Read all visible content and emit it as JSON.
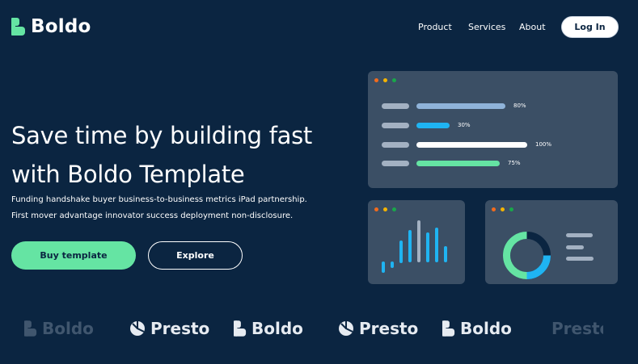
{
  "brand": {
    "name": "Boldo",
    "accent": "#65e4a3"
  },
  "nav": {
    "items": [
      {
        "label": "Product"
      },
      {
        "label": "Services"
      },
      {
        "label": "About"
      }
    ],
    "login_label": "Log In"
  },
  "hero": {
    "title_line1": "Save time by building fast",
    "title_line2": "with Boldo Template",
    "description": "Funding handshake buyer business-to-business metrics iPad partnership. First mover advantage innovator success deployment non-disclosure.",
    "primary_button": "Buy template",
    "secondary_button": "Explore"
  },
  "progress_card": {
    "bars": [
      {
        "value": 0.8,
        "label": "80%",
        "color": "#8fb3d9"
      },
      {
        "value": 0.3,
        "label": "30%",
        "color": "#1fb4f2"
      },
      {
        "value": 1.0,
        "label": "100%",
        "color": "#ffffff"
      },
      {
        "value": 0.75,
        "label": "75%",
        "color": "#65e4a3"
      }
    ]
  },
  "window_dots": [
    "#f26b1d",
    "#f4b400",
    "#19a74a"
  ],
  "logo_strip": [
    {
      "name": "Boldo",
      "icon": "boldo-icon",
      "faded": true
    },
    {
      "name": "Presto",
      "icon": "presto-icon",
      "faded": false
    },
    {
      "name": "Boldo",
      "icon": "boldo-icon",
      "faded": false
    },
    {
      "name": "Presto",
      "icon": "presto-icon",
      "faded": false
    },
    {
      "name": "Boldo",
      "icon": "boldo-icon",
      "faded": false
    },
    {
      "name": "Presto",
      "icon": "presto-icon",
      "faded": true
    }
  ]
}
